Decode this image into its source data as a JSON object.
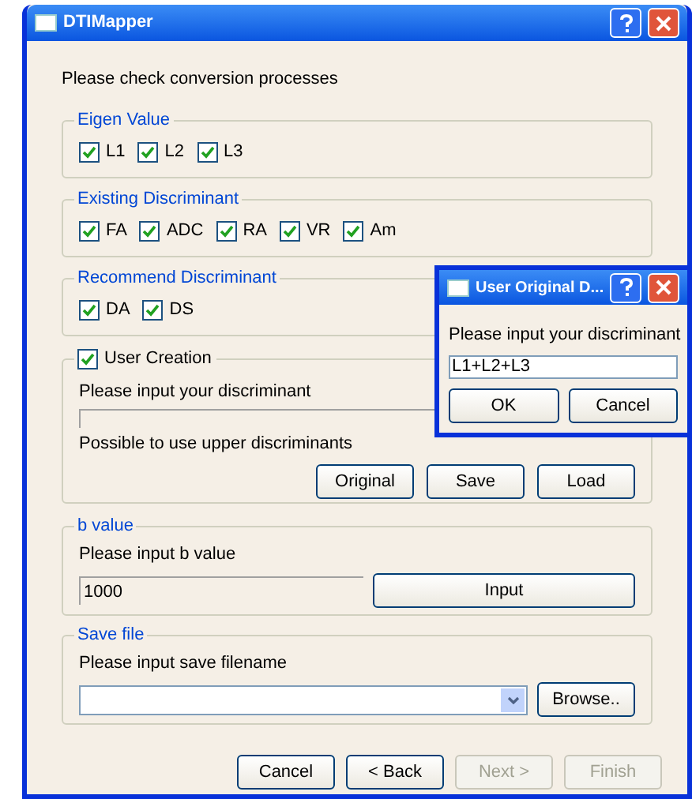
{
  "window": {
    "title": "DTIMapper"
  },
  "instruction": "Please check conversion processes",
  "check_groups": [
    {
      "title": "Eigen Value",
      "items": [
        {
          "label": "L1",
          "checked": true
        },
        {
          "label": "L2",
          "checked": true
        },
        {
          "label": "L3",
          "checked": true
        }
      ]
    },
    {
      "title": "Existing Discriminant",
      "items": [
        {
          "label": "FA",
          "checked": true
        },
        {
          "label": "ADC",
          "checked": true
        },
        {
          "label": "RA",
          "checked": true
        },
        {
          "label": "VR",
          "checked": true
        },
        {
          "label": "Am",
          "checked": true
        }
      ]
    },
    {
      "title": "Recommend Discriminant",
      "items": [
        {
          "label": "DA",
          "checked": true
        },
        {
          "label": "DS",
          "checked": true
        }
      ]
    }
  ],
  "user_creation": {
    "label": "User Creation",
    "checked": true,
    "prompt": "Please input your discriminant",
    "hint": "Possible to use upper discriminants",
    "buttons": [
      "Original",
      "Save",
      "Load"
    ]
  },
  "b_value": {
    "title": "b value",
    "prompt": "Please input b value",
    "value": "1000",
    "button": "Input"
  },
  "save_file": {
    "title": "Save file",
    "prompt": "Please input save filename",
    "button": "Browse.."
  },
  "footer_buttons": [
    {
      "label": "Cancel",
      "disabled": false
    },
    {
      "label": "< Back",
      "disabled": false
    },
    {
      "label": "Next >",
      "disabled": true
    },
    {
      "label": "Finish",
      "disabled": true
    }
  ],
  "dialog": {
    "title": "User Original D...",
    "prompt": "Please input your discriminant",
    "value": "L1+L2+L3",
    "buttons": [
      "OK",
      "Cancel"
    ]
  }
}
